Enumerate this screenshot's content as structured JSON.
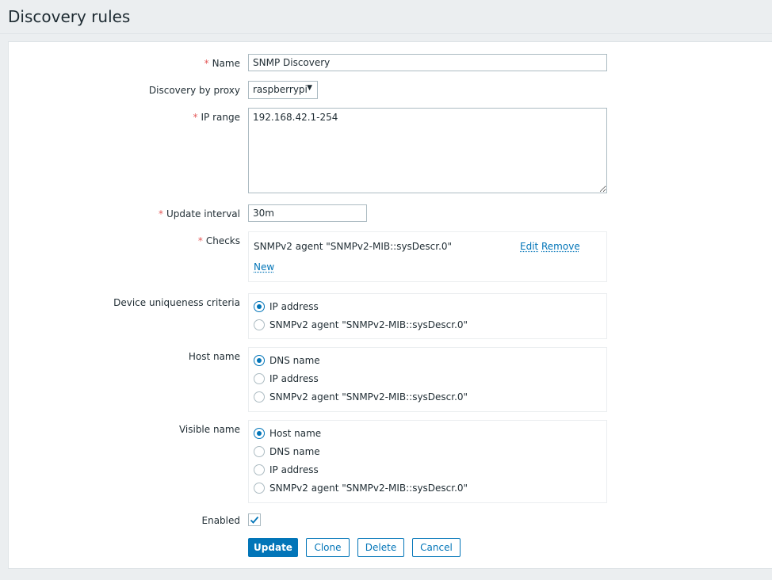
{
  "page": {
    "title": "Discovery rules"
  },
  "form": {
    "name": {
      "required": "*",
      "label": "Name",
      "value": "SNMP Discovery"
    },
    "proxy": {
      "label": "Discovery by proxy",
      "value": "raspberrypi",
      "arrow": "▼"
    },
    "ip_range": {
      "required": "*",
      "label": "IP range",
      "value": "192.168.42.1-254"
    },
    "update_interval": {
      "required": "*",
      "label": "Update interval",
      "value": "30m"
    },
    "checks": {
      "required": "*",
      "label": "Checks",
      "items": [
        {
          "text": "SNMPv2 agent \"SNMPv2-MIB::sysDescr.0\"",
          "edit": "Edit",
          "remove": "Remove"
        }
      ],
      "new_label": "New"
    },
    "uniqueness": {
      "label": "Device uniqueness criteria",
      "options": [
        "IP address",
        "SNMPv2 agent \"SNMPv2-MIB::sysDescr.0\""
      ],
      "selected": 0
    },
    "host_name": {
      "label": "Host name",
      "options": [
        "DNS name",
        "IP address",
        "SNMPv2 agent \"SNMPv2-MIB::sysDescr.0\""
      ],
      "selected": 0
    },
    "visible_name": {
      "label": "Visible name",
      "options": [
        "Host name",
        "DNS name",
        "IP address",
        "SNMPv2 agent \"SNMPv2-MIB::sysDescr.0\""
      ],
      "selected": 0
    },
    "enabled": {
      "label": "Enabled",
      "checked": true
    }
  },
  "buttons": {
    "update": "Update",
    "clone": "Clone",
    "delete": "Delete",
    "cancel": "Cancel"
  },
  "colors": {
    "accent": "#0275b8",
    "required": "#e45959",
    "background": "#ebeef0",
    "border": "#acbbc2"
  }
}
